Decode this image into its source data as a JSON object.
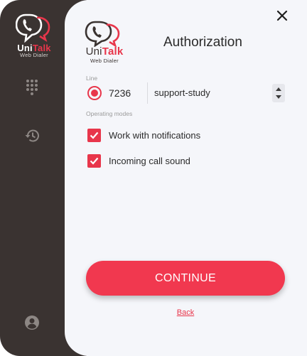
{
  "brand": {
    "name_uni": "Uni",
    "name_talk": "Talk",
    "subtitle": "Web Dialer",
    "accent_color": "#e8364b",
    "dark_color": "#3a3331"
  },
  "sidebar": {
    "items": [
      {
        "icon": "dialpad-icon"
      },
      {
        "icon": "history-icon"
      },
      {
        "icon": "account-icon"
      }
    ]
  },
  "header": {
    "title": "Authorization",
    "close_icon": "close-icon"
  },
  "line": {
    "label": "Line",
    "number": "7236",
    "name": "support-study",
    "selected": true
  },
  "modes": {
    "label": "Operating modes",
    "options": [
      {
        "label": "Work with notifications",
        "checked": true
      },
      {
        "label": "Incoming call sound",
        "checked": true
      }
    ]
  },
  "actions": {
    "continue_label": "CONTINUE",
    "back_label": "Back"
  }
}
